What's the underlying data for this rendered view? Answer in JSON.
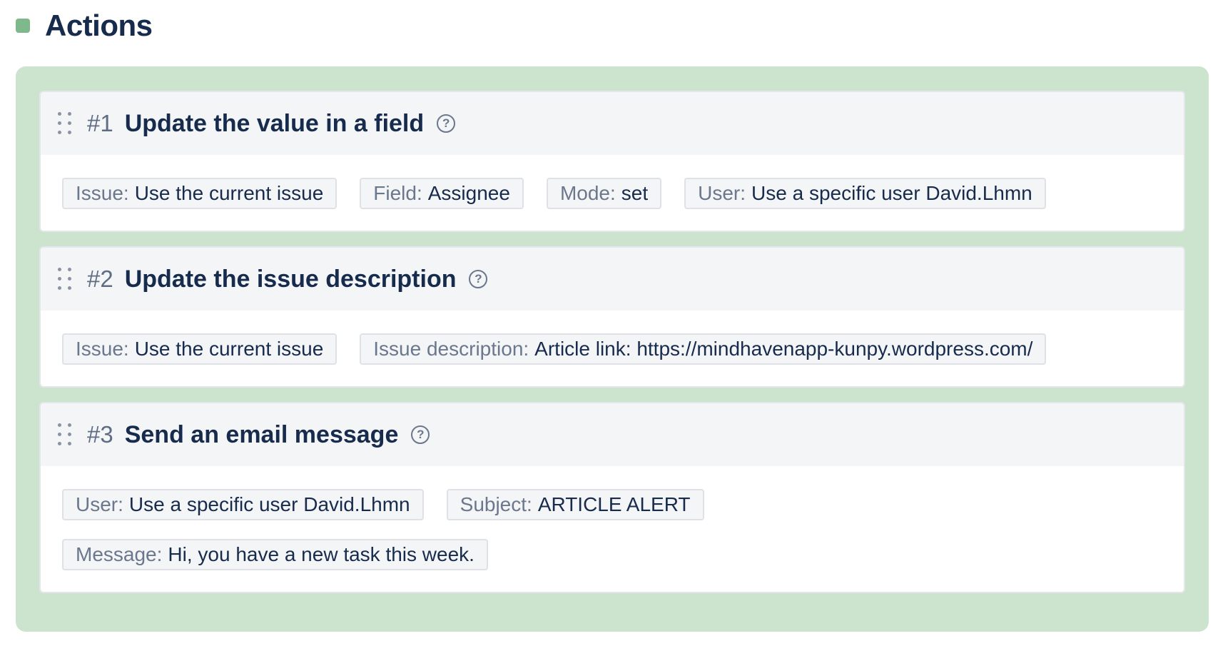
{
  "section": {
    "title": "Actions"
  },
  "actions": [
    {
      "number": "#1",
      "title": "Update the value in a field",
      "params": [
        {
          "key": "Issue:",
          "value": "Use the current issue"
        },
        {
          "key": "Field:",
          "value": "Assignee"
        },
        {
          "key": "Mode:",
          "value": "set"
        },
        {
          "key": "User:",
          "value": "Use a specific user David.Lhmn"
        }
      ]
    },
    {
      "number": "#2",
      "title": "Update the issue description",
      "params": [
        {
          "key": "Issue:",
          "value": "Use the current issue"
        },
        {
          "key": "Issue description:",
          "value": "Article link: https://mindhavenapp-kunpy.wordpress.com/"
        }
      ]
    },
    {
      "number": "#3",
      "title": "Send an email message",
      "params": [
        {
          "key": "User:",
          "value": "Use a specific user David.Lhmn"
        },
        {
          "key": "Subject:",
          "value": "ARTICLE ALERT"
        },
        {
          "key": "Message:",
          "value": "Hi, you have a new task this week."
        }
      ]
    }
  ],
  "icons": {
    "help": "question-circle-icon",
    "drag": "drag-handle-icon"
  },
  "colors": {
    "panel_background": "#cce3ce",
    "bullet": "#7fb88a",
    "card_header": "#f4f5f7",
    "tag_background": "#f4f5f7"
  }
}
